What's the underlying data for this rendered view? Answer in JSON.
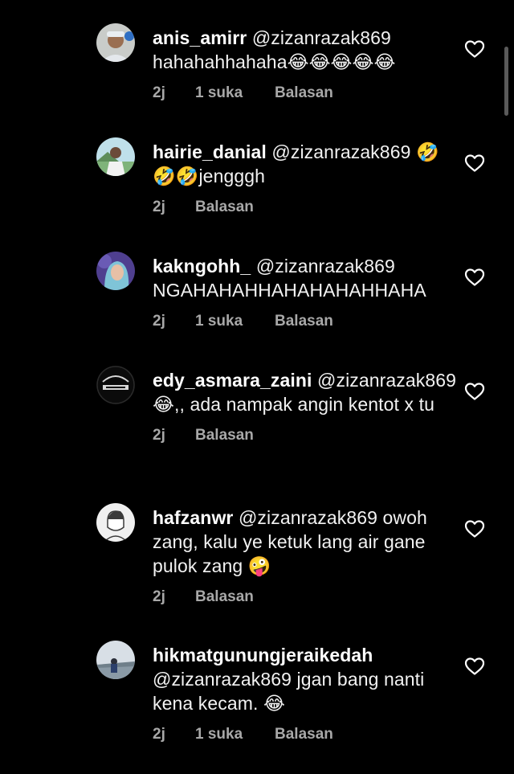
{
  "colors": {
    "background": "#000000",
    "text": "#f2f2f2",
    "meta": "#a8a8a8",
    "heart_outline": "#ffffff"
  },
  "comments": [
    {
      "username": "anis_amirr",
      "text": "@zizanrazak869 hahahahhahaha😂😂😂😂😂",
      "time": "2j",
      "likes": "1 suka",
      "reply": "Balasan",
      "avatar_icon": "avatar-boy-icon"
    },
    {
      "username": "hairie_danial",
      "text": "@zizanrazak869 🤣🤣🤣jengggh",
      "time": "2j",
      "likes": "",
      "reply": "Balasan",
      "avatar_icon": "avatar-outdoor-icon"
    },
    {
      "username": "kakngohh_",
      "text": "@zizanrazak869 NGAHAHAHHAHAHAHAHHAHA",
      "time": "2j",
      "likes": "1 suka",
      "reply": "Balasan",
      "avatar_icon": "avatar-hijab-icon"
    },
    {
      "username": "edy_asmara_zaini",
      "text": "@zizanrazak869 😂,, ada nampak angin kentot x tu",
      "time": "2j",
      "likes": "",
      "reply": "Balasan",
      "avatar_icon": "avatar-logo-icon"
    },
    {
      "username": "hafzanwr",
      "text": "@zizanrazak869 owoh zang, kalu ye ketuk lang air gane pulok zang 🤪",
      "time": "2j",
      "likes": "",
      "reply": "Balasan",
      "avatar_icon": "avatar-sketch-icon"
    },
    {
      "username": "hikmatgunungjeraikedah",
      "text": "@zizanrazak869 jgan bang nanti kena kecam. 😂",
      "time": "2j",
      "likes": "1 suka",
      "reply": "Balasan",
      "avatar_icon": "avatar-landscape-icon"
    }
  ]
}
